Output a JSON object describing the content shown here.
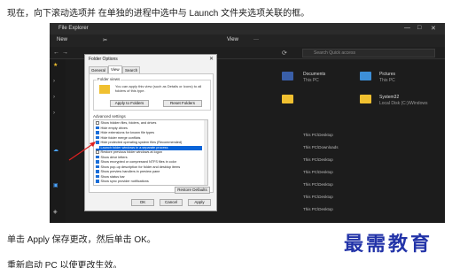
{
  "article": {
    "intro": "现在，向下滚动选项并 在单独的进程中选中与 Launch 文件夹选项关联的框。",
    "step_apply": "单击 Apply 保存更改，然后单击 OK。",
    "step_restart": "重新启动 PC 以使更改生效。",
    "watermark": "最需教育"
  },
  "explorer": {
    "title": "File Explorer",
    "toolbar": {
      "new": "New",
      "view": "View",
      "more": "···"
    },
    "search_placeholder": "Search Quick access",
    "folders": [
      {
        "name": "Documents",
        "sub": "This PC"
      },
      {
        "name": "Pictures",
        "sub": "This PC"
      },
      {
        "name": "System32",
        "sub": "Local Disk (C:)\\Windows"
      }
    ],
    "rows": [
      "This PC\\Desktop",
      "This PC\\Downloads",
      "This PC\\Desktop",
      "This PC\\Desktop",
      "This PC\\Desktop",
      "This PC\\Desktop",
      "This PC\\Desktop"
    ]
  },
  "dialog": {
    "title": "Folder Options",
    "close": "✕",
    "tabs": [
      "General",
      "View",
      "Search"
    ],
    "folder_views_label": "Folder views",
    "folder_views_text": "You can apply this view (such as Details or Icons) to all folders of this type.",
    "apply_to_folders": "Apply to Folders",
    "reset_folders": "Reset Folders",
    "advanced_label": "Advanced settings",
    "settings": [
      {
        "label": "Show hidden files, folders, and drives",
        "checked": false
      },
      {
        "label": "Hide empty drives",
        "checked": true
      },
      {
        "label": "Hide extensions for known file types",
        "checked": true
      },
      {
        "label": "Hide folder merge conflicts",
        "checked": true
      },
      {
        "label": "Hide protected operating system files (Recommended)",
        "checked": true
      },
      {
        "label": "Launch folder windows in a separate process",
        "checked": true,
        "selected": true
      },
      {
        "label": "Restore previous folder windows at logon",
        "checked": false
      },
      {
        "label": "Show drive letters",
        "checked": true
      },
      {
        "label": "Show encrypted or compressed NTFS files in color",
        "checked": true
      },
      {
        "label": "Show pop-up description for folder and desktop items",
        "checked": true
      },
      {
        "label": "Show preview handlers in preview pane",
        "checked": true
      },
      {
        "label": "Show status bar",
        "checked": true
      },
      {
        "label": "Show sync provider notifications",
        "checked": true
      }
    ],
    "restore_defaults": "Restore Defaults",
    "ok": "OK",
    "cancel": "Cancel",
    "apply": "Apply"
  },
  "colors": {
    "accent": "#0a64d8",
    "arrow": "#e02020",
    "watermark": "#2233a8"
  }
}
